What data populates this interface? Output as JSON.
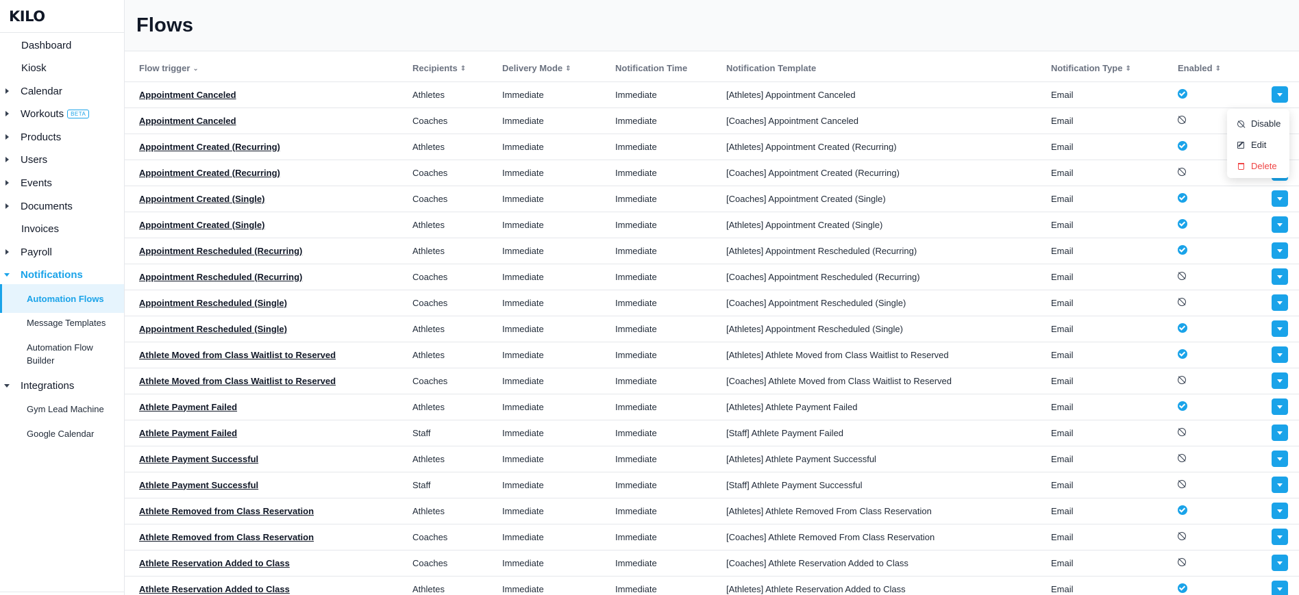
{
  "app": {
    "logo_text": "KILO"
  },
  "sidebar": {
    "items": [
      {
        "label": "Dashboard",
        "caret": false
      },
      {
        "label": "Kiosk",
        "caret": false
      },
      {
        "label": "Calendar",
        "caret": true
      },
      {
        "label": "Workouts",
        "caret": true,
        "badge": "BETA"
      },
      {
        "label": "Products",
        "caret": true
      },
      {
        "label": "Users",
        "caret": true
      },
      {
        "label": "Events",
        "caret": true
      },
      {
        "label": "Documents",
        "caret": true
      },
      {
        "label": "Invoices",
        "caret": false
      },
      {
        "label": "Payroll",
        "caret": true
      },
      {
        "label": "Notifications",
        "caret": true,
        "expanded": true,
        "active": true
      },
      {
        "label": "Integrations",
        "caret": true,
        "expanded": true
      }
    ],
    "notifications_children": [
      "Automation Flows",
      "Message Templates",
      "Automation Flow Builder"
    ],
    "integrations_children": [
      "Gym Lead Machine",
      "Google Calendar"
    ],
    "active_child": "Automation Flows"
  },
  "page": {
    "title": "Flows"
  },
  "table": {
    "headers": [
      "Flow trigger",
      "Recipients",
      "Delivery Mode",
      "Notification Time",
      "Notification Template",
      "Notification Type",
      "Enabled"
    ],
    "rows": [
      {
        "trigger": "Appointment Canceled",
        "recipients": "Athletes",
        "mode": "Immediate",
        "time": "Immediate",
        "template": "[Athletes] Appointment Canceled",
        "type": "Email",
        "enabled": true
      },
      {
        "trigger": "Appointment Canceled",
        "recipients": "Coaches",
        "mode": "Immediate",
        "time": "Immediate",
        "template": "[Coaches] Appointment Canceled",
        "type": "Email",
        "enabled": false
      },
      {
        "trigger": "Appointment Created (Recurring)",
        "recipients": "Athletes",
        "mode": "Immediate",
        "time": "Immediate",
        "template": "[Athletes] Appointment Created (Recurring)",
        "type": "Email",
        "enabled": true
      },
      {
        "trigger": "Appointment Created (Recurring)",
        "recipients": "Coaches",
        "mode": "Immediate",
        "time": "Immediate",
        "template": "[Coaches] Appointment Created (Recurring)",
        "type": "Email",
        "enabled": false
      },
      {
        "trigger": "Appointment Created (Single)",
        "recipients": "Coaches",
        "mode": "Immediate",
        "time": "Immediate",
        "template": "[Coaches] Appointment Created (Single)",
        "type": "Email",
        "enabled": true
      },
      {
        "trigger": "Appointment Created (Single)",
        "recipients": "Athletes",
        "mode": "Immediate",
        "time": "Immediate",
        "template": "[Athletes] Appointment Created (Single)",
        "type": "Email",
        "enabled": true
      },
      {
        "trigger": "Appointment Rescheduled (Recurring)",
        "recipients": "Athletes",
        "mode": "Immediate",
        "time": "Immediate",
        "template": "[Athletes] Appointment Rescheduled (Recurring)",
        "type": "Email",
        "enabled": true
      },
      {
        "trigger": "Appointment Rescheduled (Recurring)",
        "recipients": "Coaches",
        "mode": "Immediate",
        "time": "Immediate",
        "template": "[Coaches] Appointment Rescheduled (Recurring)",
        "type": "Email",
        "enabled": false
      },
      {
        "trigger": "Appointment Rescheduled (Single)",
        "recipients": "Coaches",
        "mode": "Immediate",
        "time": "Immediate",
        "template": "[Coaches] Appointment Rescheduled (Single)",
        "type": "Email",
        "enabled": false
      },
      {
        "trigger": "Appointment Rescheduled (Single)",
        "recipients": "Athletes",
        "mode": "Immediate",
        "time": "Immediate",
        "template": "[Athletes] Appointment Rescheduled (Single)",
        "type": "Email",
        "enabled": true
      },
      {
        "trigger": "Athlete Moved from Class Waitlist to Reserved",
        "recipients": "Athletes",
        "mode": "Immediate",
        "time": "Immediate",
        "template": "[Athletes] Athlete Moved from Class Waitlist to Reserved",
        "type": "Email",
        "enabled": true
      },
      {
        "trigger": "Athlete Moved from Class Waitlist to Reserved",
        "recipients": "Coaches",
        "mode": "Immediate",
        "time": "Immediate",
        "template": "[Coaches] Athlete Moved from Class Waitlist to Reserved",
        "type": "Email",
        "enabled": false
      },
      {
        "trigger": "Athlete Payment Failed",
        "recipients": "Athletes",
        "mode": "Immediate",
        "time": "Immediate",
        "template": "[Athletes] Athlete Payment Failed",
        "type": "Email",
        "enabled": true
      },
      {
        "trigger": "Athlete Payment Failed",
        "recipients": "Staff",
        "mode": "Immediate",
        "time": "Immediate",
        "template": "[Staff] Athlete Payment Failed",
        "type": "Email",
        "enabled": false
      },
      {
        "trigger": "Athlete Payment Successful",
        "recipients": "Athletes",
        "mode": "Immediate",
        "time": "Immediate",
        "template": "[Athletes] Athlete Payment Successful",
        "type": "Email",
        "enabled": false
      },
      {
        "trigger": "Athlete Payment Successful",
        "recipients": "Staff",
        "mode": "Immediate",
        "time": "Immediate",
        "template": "[Staff] Athlete Payment Successful",
        "type": "Email",
        "enabled": false
      },
      {
        "trigger": "Athlete Removed from Class Reservation",
        "recipients": "Athletes",
        "mode": "Immediate",
        "time": "Immediate",
        "template": "[Athletes] Athlete Removed From Class Reservation",
        "type": "Email",
        "enabled": true
      },
      {
        "trigger": "Athlete Removed from Class Reservation",
        "recipients": "Coaches",
        "mode": "Immediate",
        "time": "Immediate",
        "template": "[Coaches] Athlete Removed From Class Reservation",
        "type": "Email",
        "enabled": false
      },
      {
        "trigger": "Athlete Reservation Added to Class",
        "recipients": "Coaches",
        "mode": "Immediate",
        "time": "Immediate",
        "template": "[Coaches] Athlete Reservation Added to Class",
        "type": "Email",
        "enabled": false
      },
      {
        "trigger": "Athlete Reservation Added to Class",
        "recipients": "Athletes",
        "mode": "Immediate",
        "time": "Immediate",
        "template": "[Athletes] Athlete Reservation Added to Class",
        "type": "Email",
        "enabled": true
      }
    ]
  },
  "dropdown": {
    "items": [
      {
        "label": "Disable",
        "icon": "disable-icon"
      },
      {
        "label": "Edit",
        "icon": "edit-icon"
      },
      {
        "label": "Delete",
        "icon": "trash-icon"
      }
    ]
  },
  "colors": {
    "accent": "#1aa3e9",
    "danger": "#ef4444"
  }
}
